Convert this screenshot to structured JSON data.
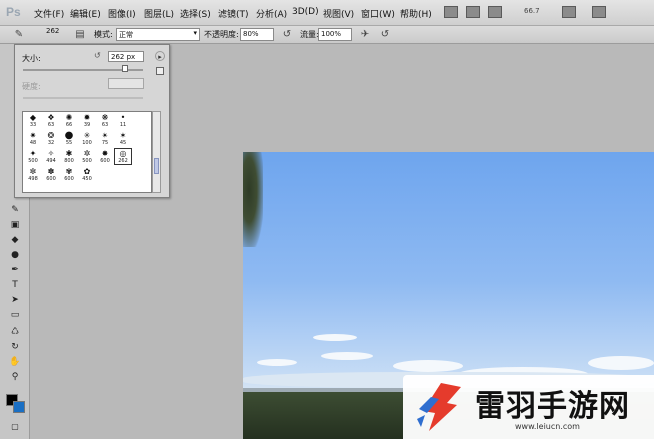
{
  "app": {
    "logo": "Ps"
  },
  "menubar": {
    "items": [
      "文件(F)",
      "编辑(E)",
      "图像(I)",
      "图层(L)",
      "选择(S)",
      "滤镜(T)",
      "分析(A)",
      "3D(D)",
      "视图(V)",
      "窗口(W)",
      "帮助(H)"
    ],
    "zoom": "66.7"
  },
  "options": {
    "brush_size_preview": "262",
    "mode_label": "模式:",
    "mode_value": "正常",
    "opacity_label": "不透明度:",
    "opacity_value": "80%",
    "flow_label": "流量:",
    "flow_value": "100%"
  },
  "brush_panel": {
    "size_label": "大小:",
    "size_value": "262 px",
    "hardness_label": "硬度:",
    "size_level_percent": 85,
    "brushes": [
      [
        "33",
        "63",
        "66",
        "39",
        "63",
        "11"
      ],
      [
        "48",
        "32",
        "55",
        "100",
        "75",
        "45"
      ],
      [
        "500",
        "494",
        "800",
        "500",
        "600",
        "262"
      ],
      [
        "498",
        "600",
        "600",
        "450",
        "",
        ""
      ]
    ]
  },
  "colors": {
    "foreground": "#000000",
    "background": "#1a6fc4"
  },
  "watermark": {
    "title": "雷羽手游网",
    "url": "www.leiucn.com"
  }
}
